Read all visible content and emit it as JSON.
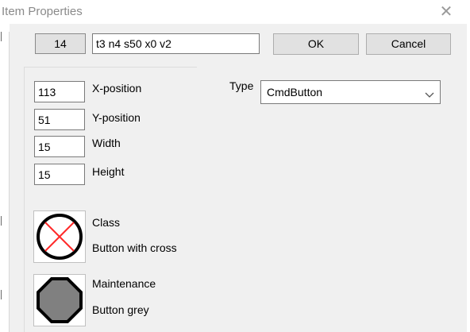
{
  "window": {
    "title": "Item Properties",
    "close_symbol": "✕"
  },
  "header": {
    "item_id": "14",
    "item_code": "t3 n4 s50 x0 v2",
    "ok_label": "OK",
    "cancel_label": "Cancel"
  },
  "geometry": {
    "x_position": {
      "value": "113",
      "label": "X-position"
    },
    "y_position": {
      "value": "51",
      "label": "Y-position"
    },
    "width": {
      "value": "15",
      "label": "Width"
    },
    "height": {
      "value": "15",
      "label": "Height"
    }
  },
  "type": {
    "label": "Type",
    "selected": "CmdButton"
  },
  "class": {
    "heading": "Class",
    "name": "Button with cross",
    "icon": "circle-cross-icon"
  },
  "maintenance": {
    "heading": "Maintenance",
    "name": "Button grey",
    "icon": "grey-octagon-icon"
  },
  "colors": {
    "cross": "#ff2a2a",
    "grey_fill": "#808080",
    "dialog_bg": "#f0f0f0",
    "button_bg": "#e1e1e1"
  }
}
